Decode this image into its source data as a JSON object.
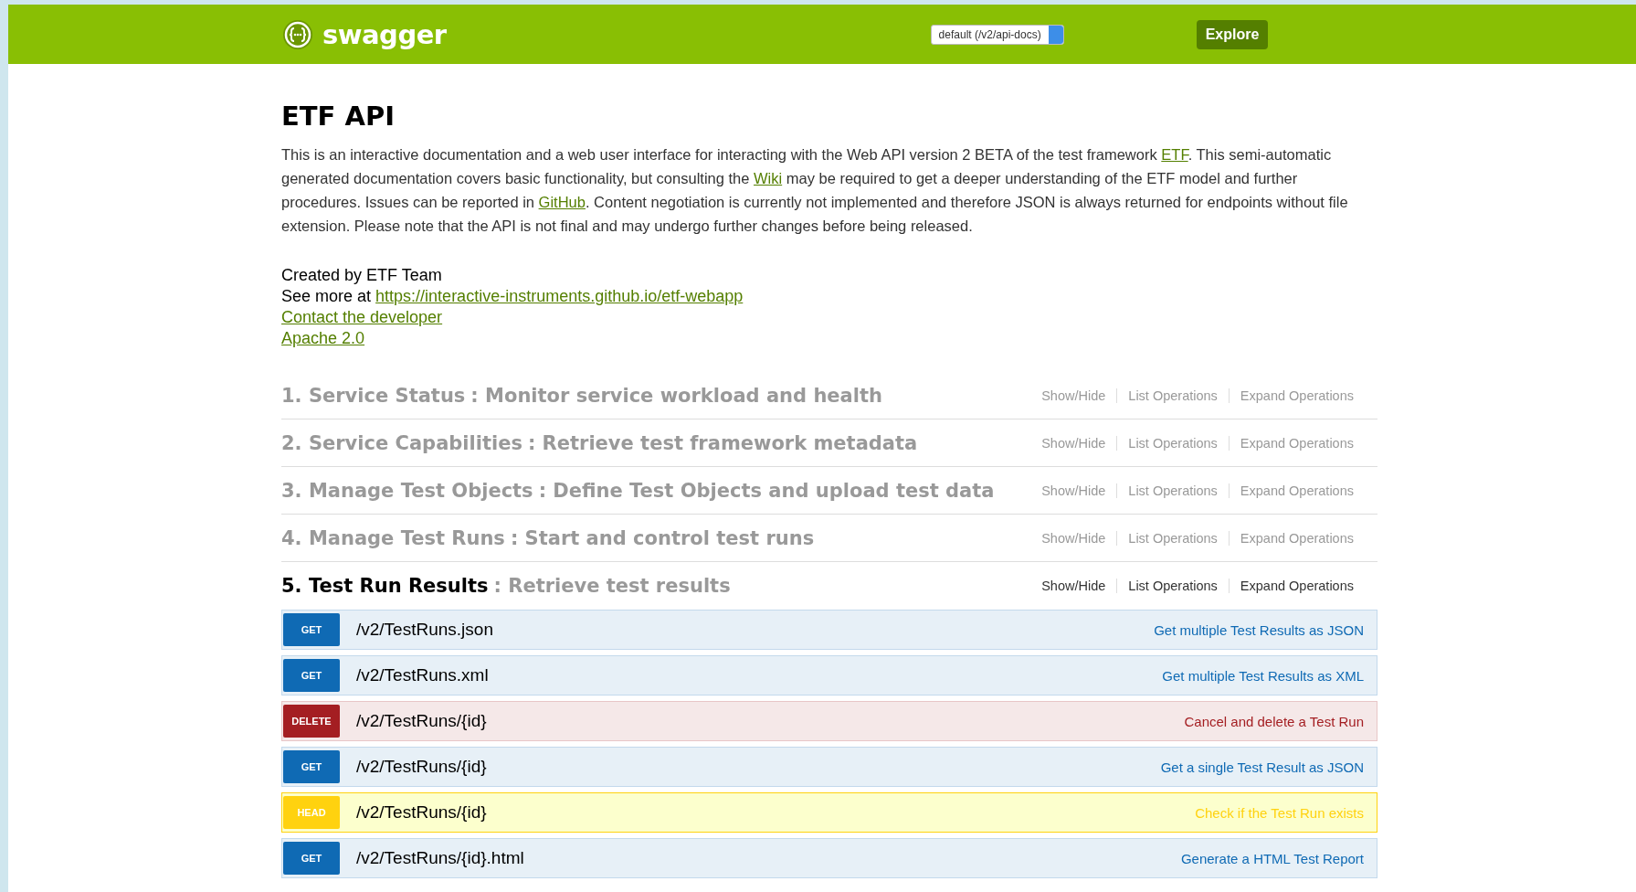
{
  "header": {
    "logo_text": "swagger",
    "spec_select": "default (/v2/api-docs)",
    "explore_button": "Explore"
  },
  "info": {
    "title": "ETF API",
    "description": [
      {
        "kind": "text",
        "text": "This is an interactive documentation and a web user interface for interacting with the Web API version 2 BETA of the test framework "
      },
      {
        "kind": "link",
        "text": "ETF"
      },
      {
        "kind": "text",
        "text": ". This semi-automatic generated documentation covers basic functionality, but consulting the "
      },
      {
        "kind": "link",
        "text": "Wiki"
      },
      {
        "kind": "text",
        "text": " may be required to get a deeper understanding of the ETF model and further procedures. Issues can be reported in "
      },
      {
        "kind": "link",
        "text": "GitHub"
      },
      {
        "kind": "text",
        "text": ". Content negotiation is currently not implemented and therefore JSON is always returned for endpoints without file extension. Please note that the API is not final and may undergo further changes before being released."
      }
    ],
    "created_by": "Created by ETF Team",
    "see_more_label": "See more at",
    "see_more_link": "https://interactive-instruments.github.io/etf-webapp",
    "contact_link": "Contact the developer",
    "license_link": "Apache 2.0"
  },
  "sections": [
    {
      "name": "1. Service Status",
      "description": ": Monitor service workload and health",
      "selected": false,
      "actions": [
        "Show/Hide",
        "List Operations",
        "Expand Operations"
      ]
    },
    {
      "name": "2. Service Capabilities",
      "description": ": Retrieve test framework metadata",
      "selected": false,
      "actions": [
        "Show/Hide",
        "List Operations",
        "Expand Operations"
      ]
    },
    {
      "name": "3. Manage Test Objects",
      "description": ": Define Test Objects and upload test data",
      "selected": false,
      "actions": [
        "Show/Hide",
        "List Operations",
        "Expand Operations"
      ]
    },
    {
      "name": "4. Manage Test Runs",
      "description": ": Start and control test runs",
      "selected": false,
      "actions": [
        "Show/Hide",
        "List Operations",
        "Expand Operations"
      ]
    },
    {
      "name": "5. Test Run Results",
      "description": ": Retrieve test results",
      "selected": true,
      "actions": [
        "Show/Hide",
        "List Operations",
        "Expand Operations"
      ]
    }
  ],
  "operations": [
    {
      "kind": "get",
      "method": "GET",
      "path": "/v2/TestRuns.json",
      "summary": "Get multiple Test Results as JSON"
    },
    {
      "kind": "get",
      "method": "GET",
      "path": "/v2/TestRuns.xml",
      "summary": "Get multiple Test Results as XML"
    },
    {
      "kind": "delete",
      "method": "DELETE",
      "path": "/v2/TestRuns/{id}",
      "summary": "Cancel and delete a Test Run"
    },
    {
      "kind": "get",
      "method": "GET",
      "path": "/v2/TestRuns/{id}",
      "summary": "Get a single Test Result as JSON"
    },
    {
      "kind": "head",
      "method": "HEAD",
      "path": "/v2/TestRuns/{id}",
      "summary": "Check if the Test Run exists"
    },
    {
      "kind": "get",
      "method": "GET",
      "path": "/v2/TestRuns/{id}.html",
      "summary": "Generate a HTML Test Report"
    }
  ]
}
